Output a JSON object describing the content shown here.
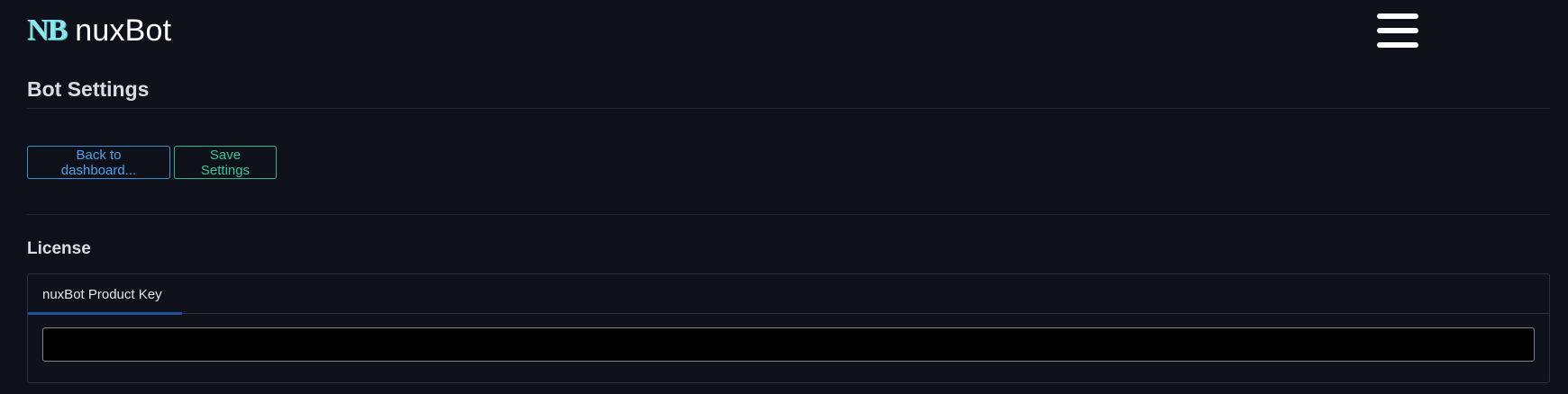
{
  "header": {
    "logo_mark": "NB",
    "brand_name": "nuxBot",
    "menu_icon": "hamburger-menu-icon"
  },
  "page": {
    "title": "Bot Settings"
  },
  "actions": {
    "back_label": "Back to dashboard...",
    "save_label": "Save Settings"
  },
  "license": {
    "section_title": "License",
    "tabs": [
      {
        "label": "nuxBot Product Key",
        "active": true
      }
    ],
    "product_key": {
      "value": "",
      "placeholder": ""
    }
  },
  "colors": {
    "background": "#0e1119",
    "logo_accent": "#8fe3ea",
    "back_button": "#4aa3ea",
    "save_button": "#36c795",
    "active_tab_underline": "#1d4f9c"
  }
}
